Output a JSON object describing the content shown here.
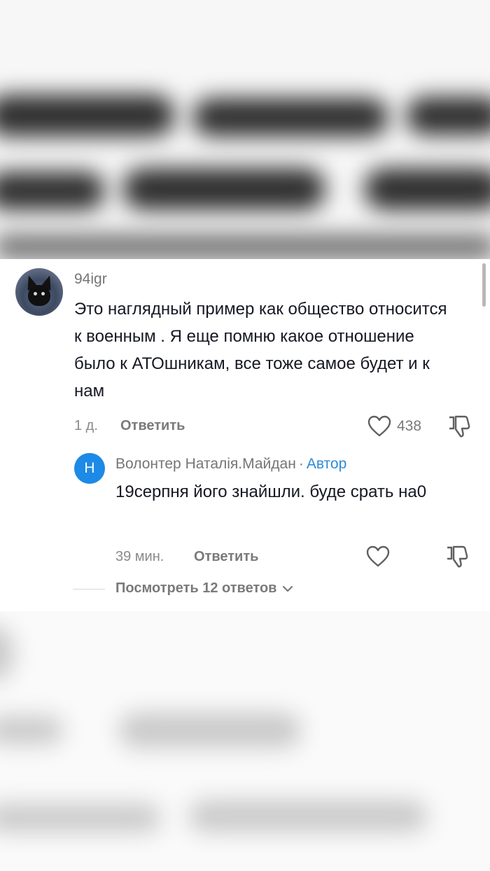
{
  "comment": {
    "username": "94igr",
    "text": "Это наглядный пример как общество относится к военным . Я еще помню какое отношение было к АТОшникам, все тоже самое будет и к нам",
    "time": "1 д.",
    "reply_label": "Ответить",
    "like_count": "438",
    "avatar_icon": "dog-avatar"
  },
  "reply": {
    "avatar_letter": "Н",
    "avatar_color": "#1c8ae6",
    "name": "Волонтер Наталія.Майдан",
    "separator": "·",
    "author_badge": "Автор",
    "text": "19серпня його знайшли. буде срать на0",
    "time": "39 мин.",
    "reply_label": "Ответить"
  },
  "view_replies": {
    "label": "Посмотреть 12 ответов"
  },
  "colors": {
    "accent_author": "#2e8bd6",
    "text_primary": "#161823",
    "text_secondary": "#757575"
  },
  "icons": [
    "heart-outline-icon",
    "dislike-icon",
    "chevron-down-icon"
  ]
}
